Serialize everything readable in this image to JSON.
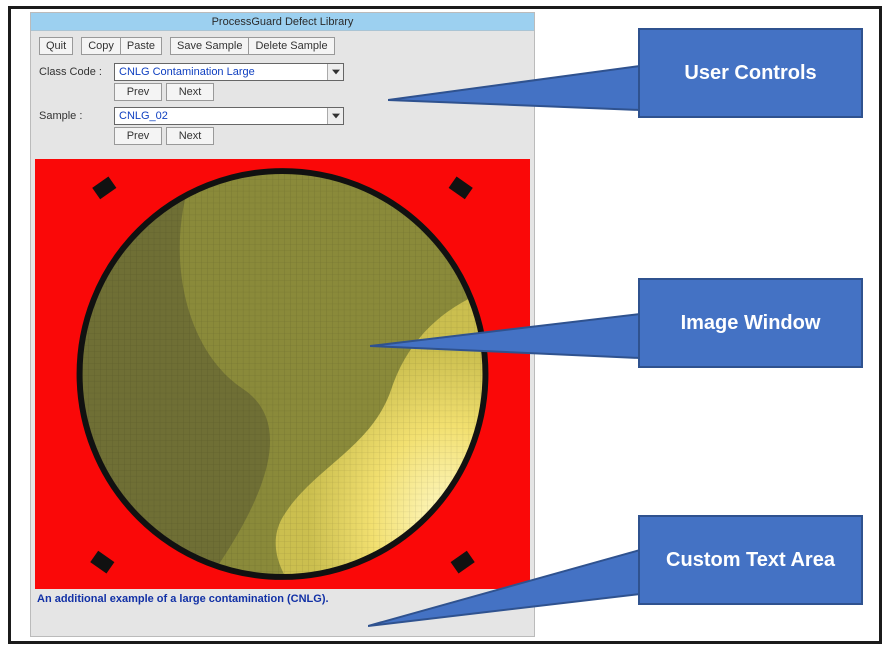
{
  "window": {
    "title": "ProcessGuard Defect Library"
  },
  "toolbar": {
    "quit": "Quit",
    "copy": "Copy",
    "paste": "Paste",
    "save_sample": "Save Sample",
    "delete_sample": "Delete Sample"
  },
  "class_code": {
    "label": "Class Code :",
    "value": "CNLG Contamination Large",
    "prev": "Prev",
    "next": "Next"
  },
  "sample": {
    "label": "Sample :",
    "value": "CNLG_02",
    "prev": "Prev",
    "next": "Next"
  },
  "caption": "An additional example of a large contamination (CNLG).",
  "callouts": {
    "user_controls": "User Controls",
    "image_window": "Image Window",
    "custom_text_area": "Custom Text Area"
  },
  "colors": {
    "callout_fill": "#4472c4",
    "callout_border": "#2f528f",
    "image_bg": "#fa0808",
    "title_bar": "#9cd0f0"
  }
}
